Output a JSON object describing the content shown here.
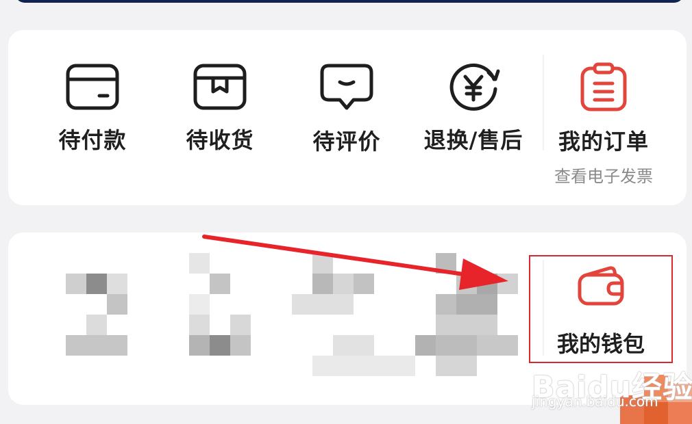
{
  "orders": {
    "items": [
      {
        "label": "待付款",
        "icon": "wallet-card-icon"
      },
      {
        "label": "待收货",
        "icon": "package-box-icon"
      },
      {
        "label": "待评价",
        "icon": "comment-bubble-icon"
      },
      {
        "label": "退换/售后",
        "icon": "yuan-refund-icon"
      },
      {
        "label": "我的订单",
        "icon": "clipboard-icon",
        "sub": "查看电子发票"
      }
    ]
  },
  "tools": {
    "wallet_label": "我的钱包",
    "wallet_icon": "wallet-icon"
  },
  "colors": {
    "accent_red": "#e2453c",
    "highlight_red": "#d9272e",
    "icon_dark": "#1e1e1e",
    "arrow_red": "#e8242b"
  },
  "watermark": {
    "logo": "Baidu经验",
    "url": "jingyan.baidu.com"
  }
}
